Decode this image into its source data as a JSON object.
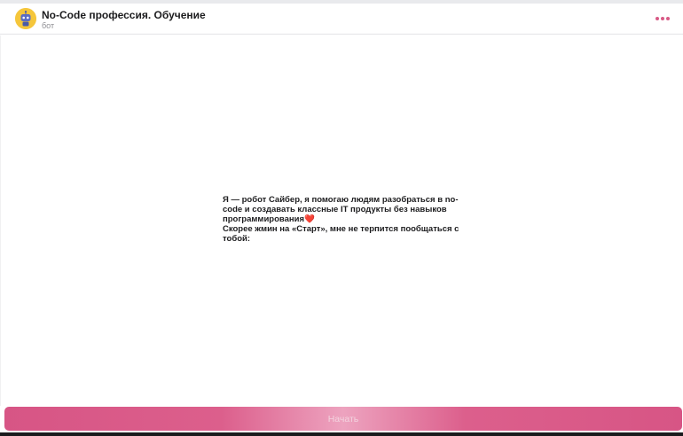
{
  "chat": {
    "title": "No-Code профессия. Обучение",
    "subtitle": "бот",
    "avatar_icon": "robot-icon",
    "menu_icon": "more-dots-icon",
    "accent_color": "#d85a86"
  },
  "message": {
    "line1": "Я — робот Сайбер, я помогаю людям разобраться в no-code и создавать классные IT продукты без навыков программирования",
    "emoji": "❤️",
    "line2": "Скорее жмин на «Старт», мне не терпится пообщаться с тобой:"
  },
  "start_button": {
    "label": "Начать"
  }
}
